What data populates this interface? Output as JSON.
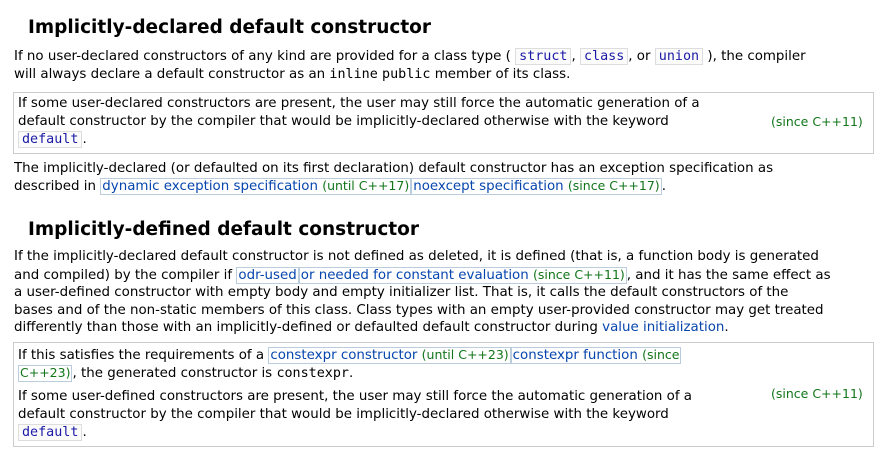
{
  "section1": {
    "heading": "Implicitly-declared default constructor",
    "p1": {
      "pre": "If no user-declared constructors of any kind are provided for a class type (",
      "kw1": "struct",
      "sep1": ",",
      "kw2": "class",
      "sep2": ", or",
      "kw3": "union",
      "post": "), the compiler",
      "line2_pre": "will always declare a default constructor as an",
      "kw_inline": "inline",
      "kw_public": "public",
      "line2_post": "member of its class."
    },
    "box": {
      "line1": "If some user-declared constructors are present, the user may still force the automatic generation of a",
      "line2": "default constructor by the compiler that would be implicitly-declared otherwise with the keyword",
      "kw_default": "default",
      "period": ".",
      "since": "(since C++11)"
    },
    "p2": {
      "line1": "The implicitly-declared (or defaulted on its first declaration) default constructor has an exception specification as",
      "line2_pre": "described in",
      "link1": "dynamic exception specification",
      "rev1": "(until C++17)",
      "link2": "noexcept specification",
      "rev2": "(since C++17)",
      "end": "."
    }
  },
  "section2": {
    "heading": "Implicitly-defined default constructor",
    "p1": {
      "line1": "If the implicitly-declared default constructor is not defined as deleted, it is defined (that is, a function body is generated",
      "line2_pre": "and compiled) by the compiler if",
      "link_odr": "odr-used",
      "link_needed": "or needed for constant evaluation",
      "rev_needed": "(since C++11)",
      "line2_post": ", and it has the same effect as",
      "line3": "a user-defined constructor with empty body and empty initializer list. That is, it calls the default constructors of the",
      "line4": "bases and of the non-static members of this class. Class types with an empty user-provided constructor may get treated",
      "line5_pre": "differently than those with an implicitly-defined or defaulted default constructor during",
      "link_value_init": "value initialization",
      "line5_end": "."
    },
    "box": {
      "l1_pre": "If this satisfies the requirements of a",
      "link_ctor": "constexpr constructor",
      "rev_ctor": "(until C++23)",
      "link_func": "constexpr function",
      "rev_func_a": "(since",
      "rev_func_b": "C++23)",
      "l2_post": ", the generated constructor is",
      "kw_constexpr": "constexpr",
      "l2_end": ".",
      "line3": "If some user-defined constructors are present, the user may still force the automatic generation of a",
      "line4": "default constructor by the compiler that would be implicitly-declared otherwise with the keyword",
      "kw_default": "default",
      "period": ".",
      "since": "(since C++11)"
    }
  }
}
